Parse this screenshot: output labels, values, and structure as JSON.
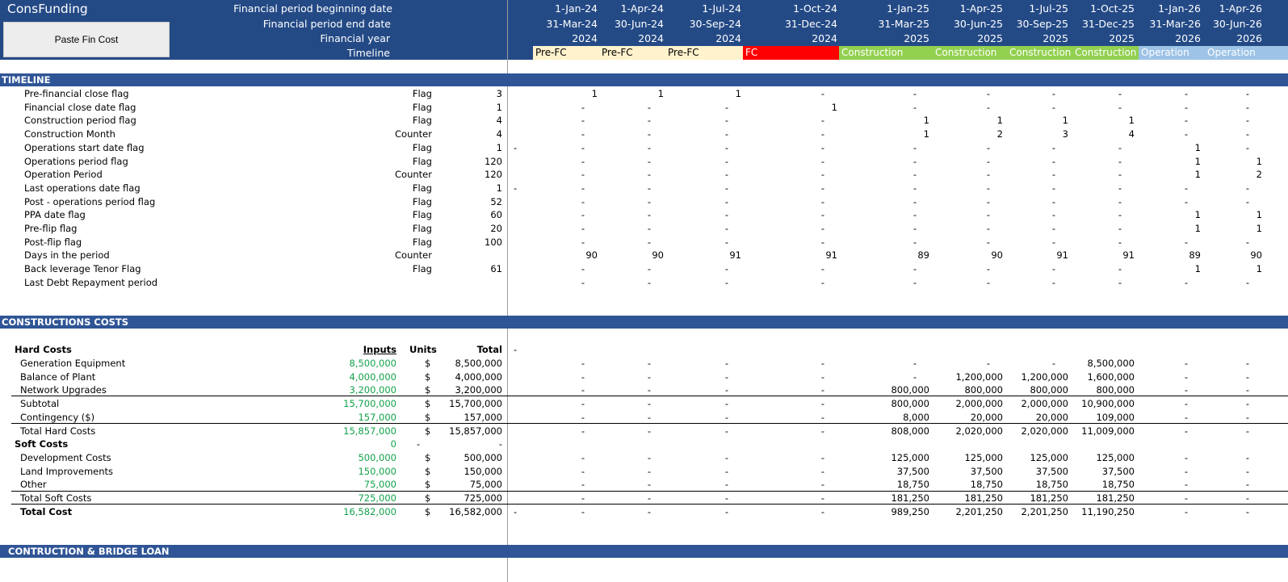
{
  "app_title": "ConsFunding",
  "paste_button_label": "Paste Fin Cost",
  "header_labels": [
    "Financial period beginning date",
    "Financial period end date",
    "Financial year",
    "Timeline"
  ],
  "periods": [
    {
      "begin": "1-Jan-24",
      "end": "31-Mar-24",
      "year": "2024",
      "phase": "Pre-FC"
    },
    {
      "begin": "1-Apr-24",
      "end": "30-Jun-24",
      "year": "2024",
      "phase": "Pre-FC"
    },
    {
      "begin": "1-Jul-24",
      "end": "30-Sep-24",
      "year": "2024",
      "phase": "Pre-FC"
    },
    {
      "begin": "1-Oct-24",
      "end": "31-Dec-24",
      "year": "2024",
      "phase": "FC"
    },
    {
      "begin": "1-Jan-25",
      "end": "31-Mar-25",
      "year": "2025",
      "phase": "Construction"
    },
    {
      "begin": "1-Apr-25",
      "end": "30-Jun-25",
      "year": "2025",
      "phase": "Construction"
    },
    {
      "begin": "1-Jul-25",
      "end": "30-Sep-25",
      "year": "2025",
      "phase": "Construction"
    },
    {
      "begin": "1-Oct-25",
      "end": "31-Dec-25",
      "year": "2025",
      "phase": "Construction"
    },
    {
      "begin": "1-Jan-26",
      "end": "31-Mar-26",
      "year": "2026",
      "phase": "Operation"
    },
    {
      "begin": "1-Apr-26",
      "end": "30-Jun-26",
      "year": "2026",
      "phase": "Operation"
    }
  ],
  "phase_colors": {
    "Pre-FC": "#fff2cc",
    "FC": "#ff0000",
    "Construction": "#92d050",
    "Operation": "#9dc3e6"
  },
  "sections": {
    "timeline": "TIMELINE",
    "construction_costs": "CONSTRUCTIONS COSTS",
    "loan": "CONTRUCTION & BRIDGE LOAN"
  },
  "timeline_rows": [
    {
      "label": "Pre-financial close flag",
      "unit": "Flag",
      "total": "3",
      "marker": "",
      "vals": [
        "1",
        "1",
        "1",
        "-",
        "-",
        "-",
        "-",
        "-",
        "-",
        "-"
      ]
    },
    {
      "label": "Financial close date flag",
      "unit": "Flag",
      "total": "1",
      "marker": "",
      "vals": [
        "-",
        "-",
        "-",
        "1",
        "-",
        "-",
        "-",
        "-",
        "-",
        "-"
      ]
    },
    {
      "label": "Construction period flag",
      "unit": "Flag",
      "total": "4",
      "marker": "",
      "vals": [
        "-",
        "-",
        "-",
        "-",
        "1",
        "1",
        "1",
        "1",
        "-",
        "-"
      ]
    },
    {
      "label": "Construction Month",
      "unit": "Counter",
      "total": "4",
      "marker": "",
      "vals": [
        "-",
        "-",
        "-",
        "-",
        "1",
        "2",
        "3",
        "4",
        "-",
        "-"
      ]
    },
    {
      "label": "Operations start date flag",
      "unit": "Flag",
      "total": "1",
      "marker": "-",
      "vals": [
        "-",
        "-",
        "-",
        "-",
        "-",
        "-",
        "-",
        "-",
        "1",
        "-"
      ]
    },
    {
      "label": "Operations period flag",
      "unit": "Flag",
      "total": "120",
      "marker": "",
      "vals": [
        "-",
        "-",
        "-",
        "-",
        "-",
        "-",
        "-",
        "-",
        "1",
        "1"
      ]
    },
    {
      "label": "Operation Period",
      "unit": "Counter",
      "total": "120",
      "marker": "",
      "vals": [
        "-",
        "-",
        "-",
        "-",
        "-",
        "-",
        "-",
        "-",
        "1",
        "2"
      ]
    },
    {
      "label": "Last operations date flag",
      "unit": "Flag",
      "total": "1",
      "marker": "-",
      "vals": [
        "-",
        "-",
        "-",
        "-",
        "-",
        "-",
        "-",
        "-",
        "-",
        "-"
      ]
    },
    {
      "label": "Post - operations period flag",
      "unit": "Flag",
      "total": "52",
      "marker": "",
      "vals": [
        "-",
        "-",
        "-",
        "-",
        "-",
        "-",
        "-",
        "-",
        "-",
        "-"
      ]
    },
    {
      "label": "PPA date flag",
      "unit": "Flag",
      "total": "60",
      "marker": "",
      "vals": [
        "-",
        "-",
        "-",
        "-",
        "-",
        "-",
        "-",
        "-",
        "1",
        "1"
      ]
    },
    {
      "label": "Pre-flip flag",
      "unit": "Flag",
      "total": "20",
      "marker": "",
      "vals": [
        "-",
        "-",
        "-",
        "-",
        "-",
        "-",
        "-",
        "-",
        "1",
        "1"
      ]
    },
    {
      "label": "Post-flip flag",
      "unit": "Flag",
      "total": "100",
      "marker": "",
      "vals": [
        "-",
        "-",
        "-",
        "-",
        "-",
        "-",
        "-",
        "-",
        "-",
        "-"
      ]
    },
    {
      "label": "Days in the period",
      "unit": "Counter",
      "total": "",
      "marker": "",
      "vals": [
        "90",
        "90",
        "91",
        "91",
        "89",
        "90",
        "91",
        "91",
        "89",
        "90"
      ]
    },
    {
      "label": "Back leverage Tenor Flag",
      "unit": "Flag",
      "total": "61",
      "marker": "",
      "vals": [
        "-",
        "-",
        "-",
        "-",
        "-",
        "-",
        "-",
        "-",
        "1",
        "1"
      ]
    },
    {
      "label": "Last Debt Repayment period",
      "unit": "",
      "total": "",
      "marker": "",
      "vals": [
        "-",
        "-",
        "-",
        "-",
        "-",
        "-",
        "-",
        "-",
        "-",
        "-"
      ]
    }
  ],
  "cost_headers": {
    "label": "Hard Costs",
    "inputs": "Inputs",
    "units": "Units",
    "total": "Total",
    "marker": "-"
  },
  "cost_rows": [
    {
      "label": "Generation Equipment",
      "input": "8,500,000",
      "unit": "$",
      "total": "8,500,000",
      "marker": "",
      "vals": [
        "-",
        "-",
        "-",
        "-",
        "-",
        "-",
        "-",
        "8,500,000",
        "-",
        "-"
      ]
    },
    {
      "label": "Balance of Plant",
      "input": "4,000,000",
      "unit": "$",
      "total": "4,000,000",
      "marker": "",
      "vals": [
        "-",
        "-",
        "-",
        "-",
        "-",
        "1,200,000",
        "1,200,000",
        "1,600,000",
        "-",
        "-"
      ]
    },
    {
      "label": "Network Upgrades",
      "input": "3,200,000",
      "unit": "$",
      "total": "3,200,000",
      "marker": "",
      "vals": [
        "-",
        "-",
        "-",
        "-",
        "800,000",
        "800,000",
        "800,000",
        "800,000",
        "-",
        "-"
      ]
    },
    {
      "label": "Subtotal",
      "input": "15,700,000",
      "unit": "$",
      "total": "15,700,000",
      "marker": "",
      "vals": [
        "-",
        "-",
        "-",
        "-",
        "800,000",
        "2,000,000",
        "2,000,000",
        "10,900,000",
        "-",
        "-"
      ]
    },
    {
      "label": "Contingency ($)",
      "input": "157,000",
      "unit": "$",
      "total": "157,000",
      "marker": "",
      "vals": [
        "-",
        "-",
        "-",
        "-",
        "8,000",
        "20,000",
        "20,000",
        "109,000",
        "-",
        "-"
      ]
    },
    {
      "label": "Total Hard Costs",
      "input": "15,857,000",
      "unit": "$",
      "total": "15,857,000",
      "marker": "",
      "vals": [
        "-",
        "-",
        "-",
        "-",
        "808,000",
        "2,020,000",
        "2,020,000",
        "11,009,000",
        "-",
        "-"
      ]
    },
    {
      "label": "Soft Costs",
      "input": "0",
      "unit": "-",
      "total": "-",
      "marker": "",
      "vals": [
        "",
        "",
        "",
        "",
        "",
        "",
        "",
        "",
        "",
        ""
      ]
    },
    {
      "label": "Development Costs",
      "input": "500,000",
      "unit": "$",
      "total": "500,000",
      "marker": "",
      "vals": [
        "-",
        "-",
        "-",
        "-",
        "125,000",
        "125,000",
        "125,000",
        "125,000",
        "-",
        "-"
      ]
    },
    {
      "label": "Land Improvements",
      "input": "150,000",
      "unit": "$",
      "total": "150,000",
      "marker": "",
      "vals": [
        "-",
        "-",
        "-",
        "-",
        "37,500",
        "37,500",
        "37,500",
        "37,500",
        "-",
        "-"
      ]
    },
    {
      "label": "Other",
      "input": "75,000",
      "unit": "$",
      "total": "75,000",
      "marker": "",
      "vals": [
        "-",
        "-",
        "-",
        "-",
        "18,750",
        "18,750",
        "18,750",
        "18,750",
        "-",
        "-"
      ]
    },
    {
      "label": "Total Soft Costs",
      "input": "725,000",
      "unit": "$",
      "total": "725,000",
      "marker": "",
      "vals": [
        "-",
        "-",
        "-",
        "-",
        "181,250",
        "181,250",
        "181,250",
        "181,250",
        "-",
        "-"
      ]
    },
    {
      "label": "Total Cost",
      "input": "16,582,000",
      "unit": "$",
      "total": "16,582,000",
      "marker": "-",
      "vals": [
        "-",
        "-",
        "-",
        "-",
        "989,250",
        "2,201,250",
        "2,201,250",
        "11,190,250",
        "-",
        "-"
      ]
    }
  ]
}
